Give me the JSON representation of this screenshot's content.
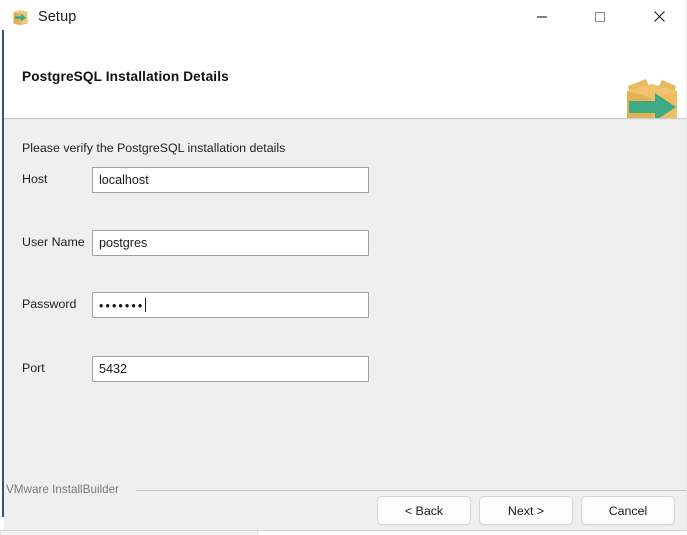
{
  "window": {
    "title": "Setup",
    "icon": "installer-box-arrow-icon",
    "controls": {
      "minimize": "minimize-icon",
      "maximize": "maximize-icon",
      "close": "close-icon"
    }
  },
  "header": {
    "page_title": "PostgreSQL Installation Details",
    "banner_icon": "open-box-green-arrow-icon"
  },
  "body": {
    "instruction": "Please verify the PostgreSQL installation details",
    "fields": [
      {
        "label": "Host",
        "value": "localhost",
        "type": "text"
      },
      {
        "label": "User Name",
        "value": "postgres",
        "type": "text"
      },
      {
        "label": "Password",
        "value": "•••••••",
        "type": "password",
        "masked_length": 7,
        "focused": true
      },
      {
        "label": "Port",
        "value": "5432",
        "type": "text"
      }
    ]
  },
  "footer": {
    "brand": "VMware InstallBuilder",
    "buttons": [
      {
        "label": "< Back",
        "name": "back-button"
      },
      {
        "label": "Next >",
        "name": "next-button"
      },
      {
        "label": "Cancel",
        "name": "cancel-button"
      }
    ]
  },
  "colors": {
    "window_background": "#ffffff",
    "body_background": "#efefef",
    "accent_blue": "#2f5573",
    "box_orange": "#eab75a",
    "arrow_green": "#3fab85",
    "text_primary": "#1a1a1a",
    "text_muted": "#7a7a7a"
  }
}
